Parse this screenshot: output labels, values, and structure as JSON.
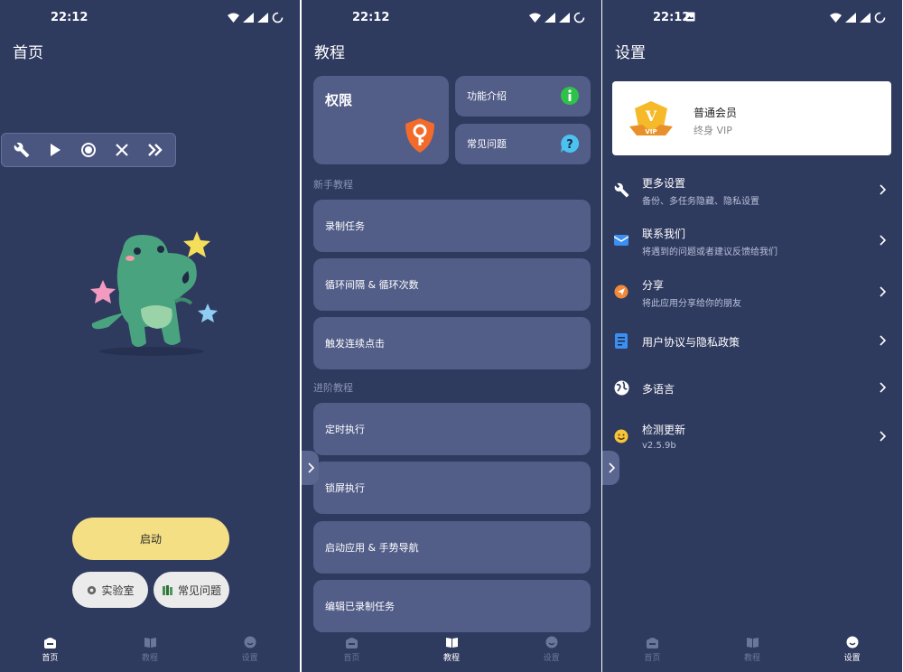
{
  "screens": {
    "home": {
      "time": "22:12",
      "title": "首页",
      "toolbar": {
        "icons": [
          "wrench-icon",
          "play-icon",
          "record-icon",
          "close-icon",
          "fast-forward-icon"
        ]
      },
      "start_label": "启动",
      "lab_label": "实验室",
      "faq_label": "常见问题",
      "nav": [
        "首页",
        "教程",
        "设置"
      ],
      "active_tab": 0
    },
    "tutorial": {
      "time": "22:12",
      "title": "教程",
      "permission_label": "权限",
      "feature_label": "功能介绍",
      "faq_label": "常见问题",
      "beginner_header": "新手教程",
      "beginner_items": [
        "录制任务",
        "循环间隔 & 循环次数",
        "触发连续点击"
      ],
      "advanced_header": "进阶教程",
      "advanced_items": [
        "定时执行",
        "锁屏执行",
        "启动应用 & 手势导航",
        "编辑已录制任务"
      ],
      "nav": [
        "首页",
        "教程",
        "设置"
      ],
      "active_tab": 1
    },
    "settings": {
      "time": "22:12",
      "title": "设置",
      "vip": {
        "title": "普通会员",
        "subtitle": "终身 VIP",
        "badge_text": "VIP",
        "badge_letter": "V"
      },
      "rows": [
        {
          "icon": "wrench-icon",
          "title": "更多设置",
          "subtitle": "备份、多任务隐藏、隐私设置"
        },
        {
          "icon": "mail-icon",
          "title": "联系我们",
          "subtitle": "将遇到的问题或者建议反馈给我们"
        },
        {
          "icon": "share-icon",
          "title": "分享",
          "subtitle": "将此应用分享给你的朋友"
        },
        {
          "icon": "document-icon",
          "title": "用户协议与隐私政策",
          "subtitle": ""
        },
        {
          "icon": "globe-icon",
          "title": "多语言",
          "subtitle": ""
        },
        {
          "icon": "smiley-icon",
          "title": "检测更新",
          "subtitle": "v2.5.9b"
        }
      ],
      "nav": [
        "首页",
        "教程",
        "设置"
      ],
      "active_tab": 2
    }
  },
  "colors": {
    "background": "#2f3a5f",
    "card": "#525d88",
    "start_button": "#f5df85",
    "nav_inactive": "#6c7698"
  }
}
